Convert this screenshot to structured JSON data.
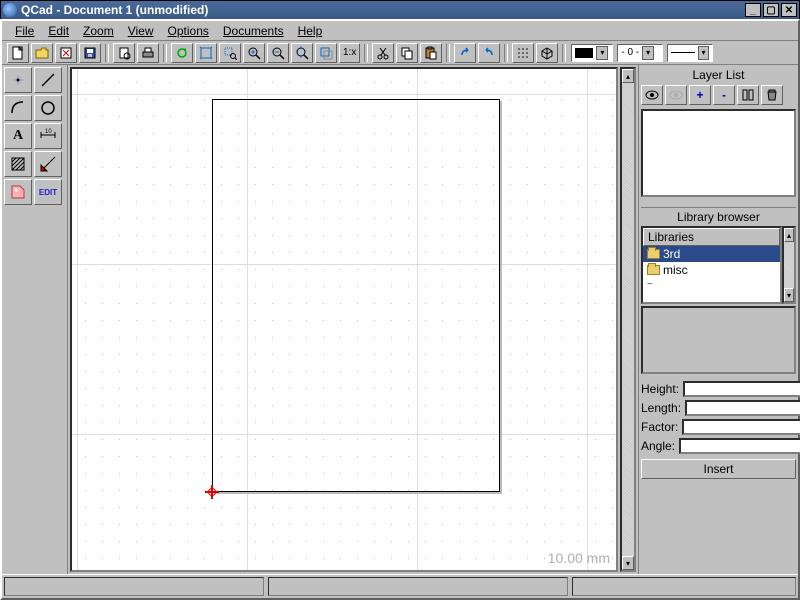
{
  "window": {
    "title": "QCad - Document 1 (unmodified)"
  },
  "menus": [
    "File",
    "Edit",
    "Zoom",
    "View",
    "Options",
    "Documents",
    "Help"
  ],
  "toolbar": {
    "zoom_ratio": "1:x",
    "lineweight": "- 0 -"
  },
  "canvas": {
    "scale_label": "10.00 mm"
  },
  "right": {
    "layer_title": "Layer List",
    "library_title": "Library browser",
    "lib_header": "Libraries",
    "lib_items": [
      "3rd",
      "misc"
    ],
    "form": {
      "height_label": "Height:",
      "length_label": "Length:",
      "factor_label": "Factor:",
      "angle_label": "Angle:",
      "height": "",
      "length": "",
      "factor": "",
      "angle": ""
    },
    "insert_label": "Insert"
  },
  "left_tools": {
    "edit_label": "EDIT"
  }
}
